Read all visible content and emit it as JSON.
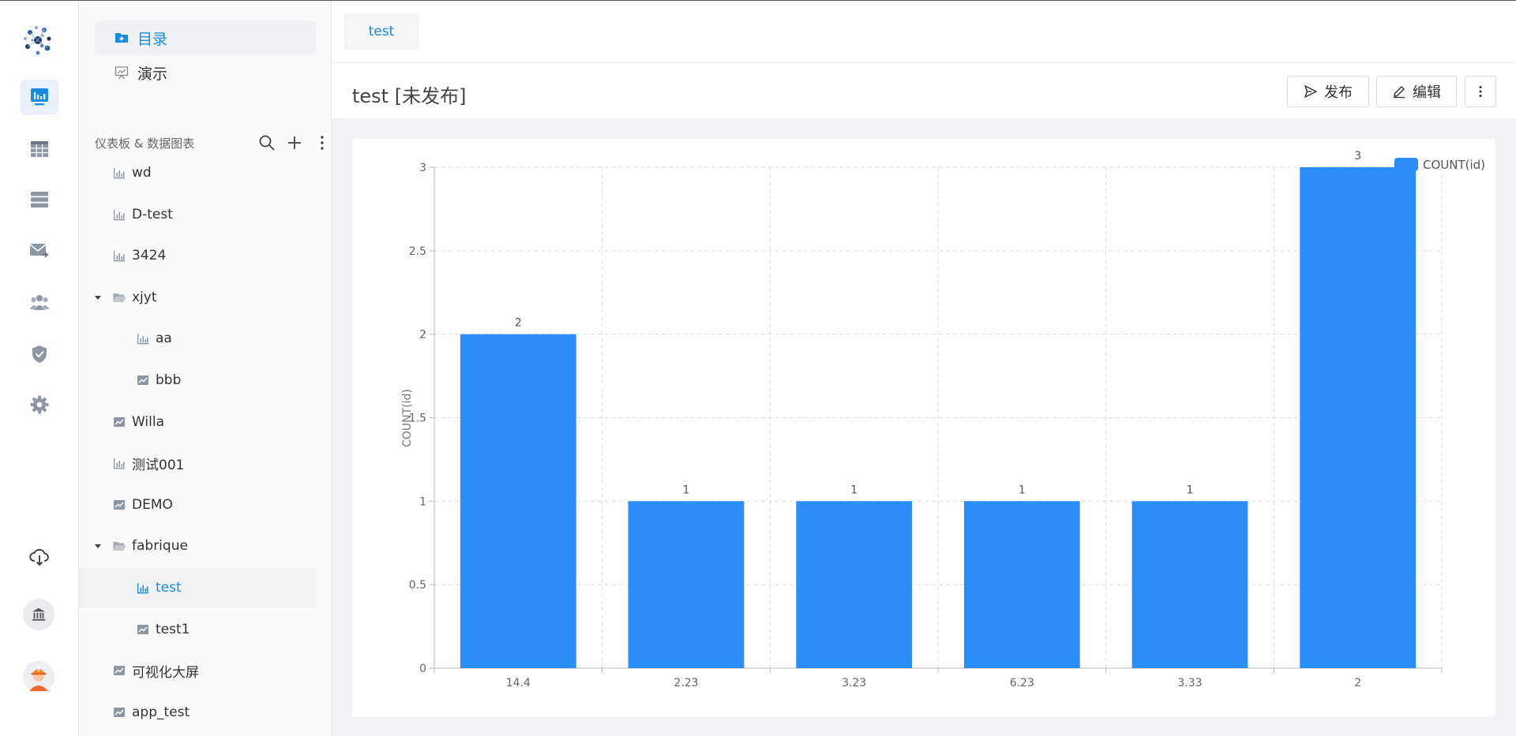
{
  "nav": {
    "items": [
      {
        "label": "目录",
        "icon": "folder-add-icon",
        "active": true
      },
      {
        "label": "演示",
        "icon": "presentation-icon",
        "active": false
      }
    ]
  },
  "section": {
    "title": "仪表板 & 数据图表",
    "icons": [
      "search-icon",
      "plus-icon",
      "more-vertical-icon"
    ]
  },
  "tree": {
    "rows": [
      {
        "label": "wd",
        "icon": "bar-chart-icon",
        "depth": 0,
        "folder": false
      },
      {
        "label": "D-test",
        "icon": "bar-chart-icon",
        "depth": 0,
        "folder": false
      },
      {
        "label": "3424",
        "icon": "bar-chart-icon",
        "depth": 0,
        "folder": false
      },
      {
        "label": "xjyt",
        "icon": "folder-open-icon",
        "depth": 0,
        "folder": true
      },
      {
        "label": "aa",
        "icon": "bar-chart-icon",
        "depth": 1,
        "folder": false
      },
      {
        "label": "bbb",
        "icon": "line-chart-icon",
        "depth": 1,
        "folder": false
      },
      {
        "label": "Willa",
        "icon": "line-chart-icon",
        "depth": 0,
        "folder": false
      },
      {
        "label": "测试001",
        "icon": "bar-chart-icon",
        "depth": 0,
        "folder": false
      },
      {
        "label": "DEMO",
        "icon": "line-chart-icon",
        "depth": 0,
        "folder": false
      },
      {
        "label": "fabrique",
        "icon": "folder-open-icon",
        "depth": 0,
        "folder": true
      },
      {
        "label": "test",
        "icon": "bar-chart-icon",
        "depth": 1,
        "folder": false,
        "selected": true
      },
      {
        "label": "test1",
        "icon": "line-chart-icon",
        "depth": 1,
        "folder": false
      },
      {
        "label": "可视化大屏",
        "icon": "line-chart-icon",
        "depth": 0,
        "folder": false
      },
      {
        "label": "app_test",
        "icon": "line-chart-icon",
        "depth": 0,
        "folder": false
      }
    ]
  },
  "tabs": [
    {
      "label": "test"
    }
  ],
  "header": {
    "title": "test [未发布]",
    "publish_label": "发布",
    "edit_label": "编辑"
  },
  "colors": {
    "accent": "#1a8cde",
    "bar": "#2b8ef8",
    "active_bg": "#e8f1fb"
  },
  "chart_data": {
    "type": "bar",
    "categories": [
      "14.4",
      "2.23",
      "3.23",
      "6.23",
      "3.33",
      "2"
    ],
    "series": [
      {
        "name": "COUNT(id)",
        "values": [
          2,
          1,
          1,
          1,
          1,
          3
        ]
      }
    ],
    "ylabel": "COUNT(id)",
    "ylim": [
      0,
      3
    ],
    "yticks": [
      "0",
      "0.5",
      "1",
      "1.5",
      "2",
      "2.5",
      "3"
    ],
    "data_labels": [
      "2",
      "1",
      "1",
      "1",
      "1",
      "3"
    ],
    "grid": true,
    "legend_placement": "top-right"
  }
}
